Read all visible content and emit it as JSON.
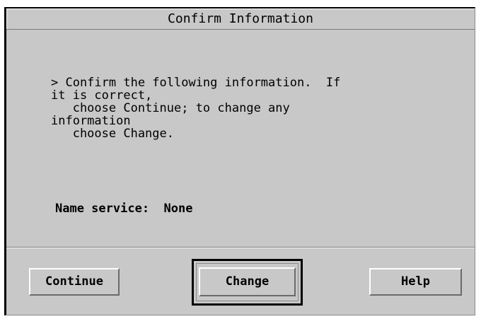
{
  "dialog": {
    "title": "Confirm Information",
    "message_lines": [
      "> Confirm the following information.  If",
      "it is correct,",
      "   choose Continue; to change any",
      "information",
      "   choose Change."
    ],
    "name_service": {
      "label": "Name service:",
      "value": "None"
    }
  },
  "buttons": {
    "continue_label": "Continue",
    "change_label": "Change",
    "help_label": "Help",
    "default": "change"
  },
  "colors": {
    "dialog_background": "#c8c8c8",
    "text": "#000000"
  }
}
